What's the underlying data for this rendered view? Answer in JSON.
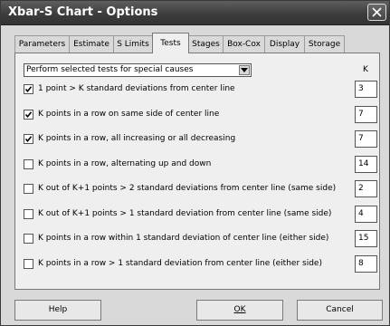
{
  "window": {
    "title": "Xbar-S Chart - Options"
  },
  "tabs": [
    {
      "label": "Parameters"
    },
    {
      "label": "Estimate"
    },
    {
      "label": "S Limits"
    },
    {
      "label": "Tests",
      "active": true
    },
    {
      "label": "Stages"
    },
    {
      "label": "Box-Cox"
    },
    {
      "label": "Display"
    },
    {
      "label": "Storage"
    }
  ],
  "tests": {
    "dropdown_value": "Perform selected tests for special causes",
    "k_header": "K",
    "items": [
      {
        "label": "1 point > K standard deviations from center line",
        "checked": true,
        "k": "3"
      },
      {
        "label": "K points in a row on same side of center line",
        "checked": true,
        "k": "7"
      },
      {
        "label": "K points in a row, all increasing or all decreasing",
        "checked": true,
        "k": "7"
      },
      {
        "label": "K points in a row, alternating up and down",
        "checked": false,
        "k": "14"
      },
      {
        "label": "K out of K+1 points > 2 standard deviations from center line (same side)",
        "checked": false,
        "k": "2"
      },
      {
        "label": "K out of K+1 points > 1 standard deviation from center line (same side)",
        "checked": false,
        "k": "4"
      },
      {
        "label": "K points in a row within 1 standard deviation of center line (either side)",
        "checked": false,
        "k": "15"
      },
      {
        "label": "K points in a row > 1 standard deviation from center line (either side)",
        "checked": false,
        "k": "8"
      }
    ]
  },
  "buttons": {
    "help": "Help",
    "ok": "OK",
    "cancel": "Cancel"
  },
  "icons": {
    "close": "close-icon",
    "dropdown": "chevron-down-icon",
    "check": "check-icon"
  }
}
